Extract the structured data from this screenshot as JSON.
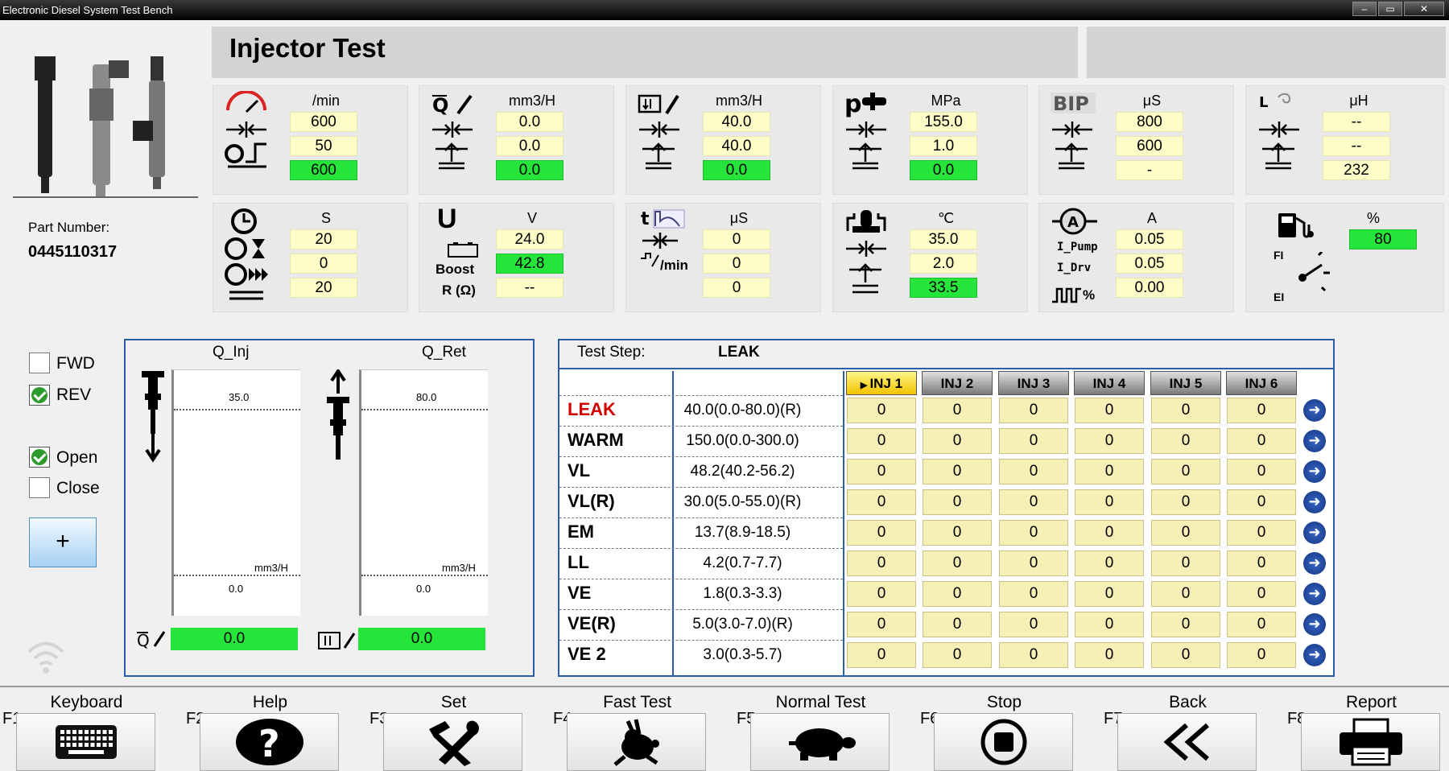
{
  "window": {
    "title": "Electronic Diesel System Test Bench",
    "min": "‒",
    "max": "▭",
    "close": "✕"
  },
  "part": {
    "label": "Part Number:",
    "value": "0445110317"
  },
  "header": {
    "title": "Injector Test"
  },
  "cards_row1": [
    {
      "unit": "/min",
      "values": [
        "600",
        "50",
        "600"
      ]
    },
    {
      "unit": "mm3/H",
      "values": [
        "0.0",
        "0.0",
        "0.0"
      ]
    },
    {
      "unit": "mm3/H",
      "values": [
        "40.0",
        "40.0",
        "0.0"
      ]
    },
    {
      "unit": "MPa",
      "icon_text": "p",
      "values": [
        "155.0",
        "1.0",
        "0.0"
      ]
    },
    {
      "unit": "μS",
      "icon_text": "BIP",
      "values": [
        "800",
        "600",
        "-"
      ]
    },
    {
      "unit": "μH",
      "icon_text": "L",
      "values": [
        "--",
        "--",
        "232"
      ]
    }
  ],
  "cards_row2": [
    {
      "unit": "S",
      "values": [
        "20",
        "0",
        "20"
      ]
    },
    {
      "unit": "V",
      "icon_text": "U",
      "boost": "Boost",
      "r": "R (Ω)",
      "values": [
        "24.0",
        "42.8",
        "--"
      ]
    },
    {
      "unit": "μS",
      "icon_text": "t",
      "min": "/min",
      "values": [
        "0",
        "0",
        "0"
      ]
    },
    {
      "unit": "℃",
      "values": [
        "35.0",
        "2.0",
        "33.5"
      ]
    },
    {
      "unit": "A",
      "icon_text": "A",
      "i_pump": "I_Pump",
      "i_drv": "I_Drv",
      "pwm": "%",
      "values": [
        "0.05",
        "0.05",
        "0.00"
      ]
    },
    {
      "unit": "%",
      "fi": "FI",
      "ei": "EI",
      "values": [
        "80"
      ]
    }
  ],
  "checks": {
    "fwd": "FWD",
    "rev": "REV",
    "open": "Open",
    "close": "Close",
    "plus": "+"
  },
  "gauges": {
    "inj": {
      "title": "Q_Inj",
      "top": "35.0",
      "bottom": "0.0",
      "unit": "mm3/H",
      "value": "0.0"
    },
    "ret": {
      "title": "Q_Ret",
      "top": "80.0",
      "bottom": "0.0",
      "unit": "mm3/H",
      "value": "0.0"
    }
  },
  "test": {
    "step_label": "Test Step:",
    "step_value": "LEAK",
    "inj_headers": [
      "INJ 1",
      "INJ 2",
      "INJ 3",
      "INJ 4",
      "INJ 5",
      "INJ 6"
    ],
    "rows": [
      {
        "name": "LEAK",
        "spec": "40.0(0.0-80.0)(R)",
        "vals": [
          "0",
          "0",
          "0",
          "0",
          "0",
          "0"
        ]
      },
      {
        "name": "WARM",
        "spec": "150.0(0.0-300.0)",
        "vals": [
          "0",
          "0",
          "0",
          "0",
          "0",
          "0"
        ]
      },
      {
        "name": "VL",
        "spec": "48.2(40.2-56.2)",
        "vals": [
          "0",
          "0",
          "0",
          "0",
          "0",
          "0"
        ]
      },
      {
        "name": "VL(R)",
        "spec": "30.0(5.0-55.0)(R)",
        "vals": [
          "0",
          "0",
          "0",
          "0",
          "0",
          "0"
        ]
      },
      {
        "name": "EM",
        "spec": "13.7(8.9-18.5)",
        "vals": [
          "0",
          "0",
          "0",
          "0",
          "0",
          "0"
        ]
      },
      {
        "name": "LL",
        "spec": "4.2(0.7-7.7)",
        "vals": [
          "0",
          "0",
          "0",
          "0",
          "0",
          "0"
        ]
      },
      {
        "name": "VE",
        "spec": "1.8(0.3-3.3)",
        "vals": [
          "0",
          "0",
          "0",
          "0",
          "0",
          "0"
        ]
      },
      {
        "name": "VE(R)",
        "spec": "5.0(3.0-7.0)(R)",
        "vals": [
          "0",
          "0",
          "0",
          "0",
          "0",
          "0"
        ]
      },
      {
        "name": "VE 2",
        "spec": "3.0(0.3-5.7)",
        "vals": [
          "0",
          "0",
          "0",
          "0",
          "0",
          "0"
        ]
      }
    ]
  },
  "fkeys": [
    {
      "key": "F1",
      "name": "Keyboard",
      "icon": "keyboard-icon"
    },
    {
      "key": "F2",
      "name": "Help",
      "icon": "help-icon"
    },
    {
      "key": "F3",
      "name": "Set",
      "icon": "tools-icon"
    },
    {
      "key": "F4",
      "name": "Fast Test",
      "icon": "rabbit-icon"
    },
    {
      "key": "F5",
      "name": "Normal Test",
      "icon": "turtle-icon"
    },
    {
      "key": "F6",
      "name": "Stop",
      "icon": "stop-icon"
    },
    {
      "key": "F7",
      "name": "Back",
      "icon": "back-icon"
    },
    {
      "key": "F8",
      "name": "Report",
      "icon": "printer-icon"
    }
  ]
}
